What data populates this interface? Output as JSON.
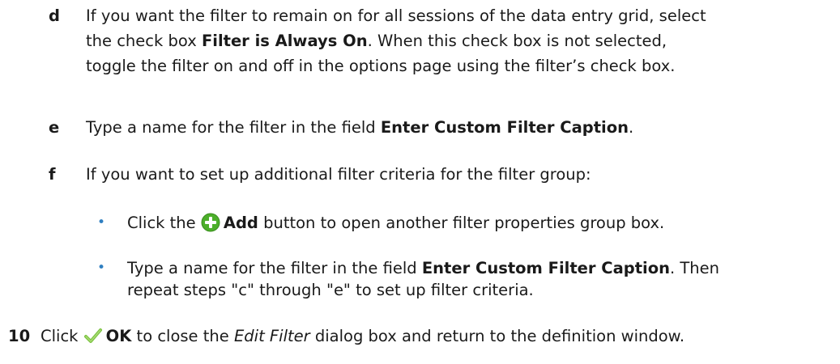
{
  "steps": {
    "d": {
      "marker": "d",
      "line1": "If you want the filter to remain on for all sessions of the data entry grid, select",
      "line2_pre": "the check box ",
      "line2_bold": "Filter is Always On",
      "line2_post": ". When this check box is not selected,",
      "line3": "toggle the filter on and off in the options page using the filter’s check box."
    },
    "e": {
      "marker": "e",
      "pre": "Type a name for the filter in the field ",
      "bold": "Enter Custom Filter Caption",
      "post": "."
    },
    "f": {
      "marker": "f",
      "text": "If you want to set up additional filter criteria for the filter group:",
      "bullets": [
        {
          "pre": "Click the ",
          "icon": "add-icon",
          "bold": "Add",
          "post": " button to open another filter properties group box."
        },
        {
          "pre": "Type a name for the filter in the field ",
          "bold": "Enter Custom Filter Caption",
          "post": ". Then",
          "line2": "repeat steps \"c\" through \"e\" to set up filter criteria."
        }
      ]
    },
    "10": {
      "marker": "10",
      "pre": "Click ",
      "icon": "checkmark-icon",
      "bold": "OK",
      "mid": " to close the ",
      "italic": "Edit Filter",
      "post": " dialog box and return to the definition window."
    }
  },
  "colors": {
    "add_icon": "#4caf2a",
    "check_icon": "#7cc242",
    "bullet": "#2f7fc1"
  }
}
